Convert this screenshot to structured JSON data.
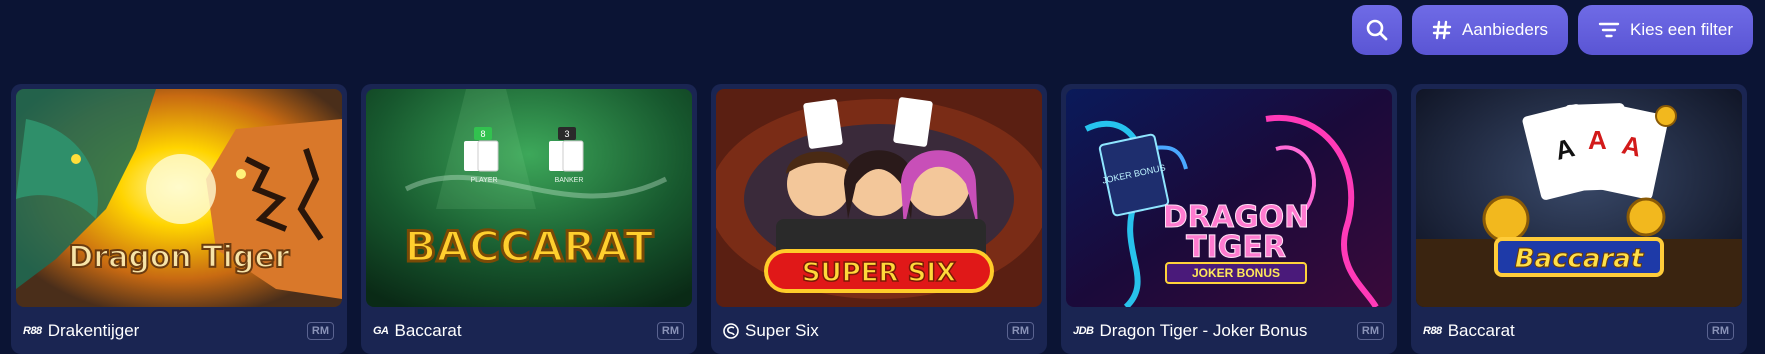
{
  "toolbar": {
    "search_icon": "search-icon",
    "providers_label": "Aanbieders",
    "filter_label": "Kies een filter",
    "accent": "#6f6be6"
  },
  "games": [
    {
      "provider": "R88",
      "name": "Drakentijger",
      "badge": "RM",
      "art_title": "Dragon Tiger"
    },
    {
      "provider": "GA",
      "name": "Baccarat",
      "badge": "RM",
      "art_title": "BACCARAT",
      "art_marker_left": "8",
      "art_marker_right": "3",
      "art_player": "PLAYER",
      "art_banker": "BANKER"
    },
    {
      "provider": "S",
      "name": "Super Six",
      "badge": "RM",
      "art_title": "SUPER SIX"
    },
    {
      "provider": "JDB",
      "name": "Dragon Tiger - Joker Bonus",
      "badge": "RM",
      "art_title_1": "DRAGON",
      "art_title_2": "TIGER",
      "art_sub": "JOKER BONUS",
      "art_card": "JOKER BONUS"
    },
    {
      "provider": "R88",
      "name": "Baccarat",
      "badge": "RM",
      "art_title": "Baccarat"
    }
  ]
}
